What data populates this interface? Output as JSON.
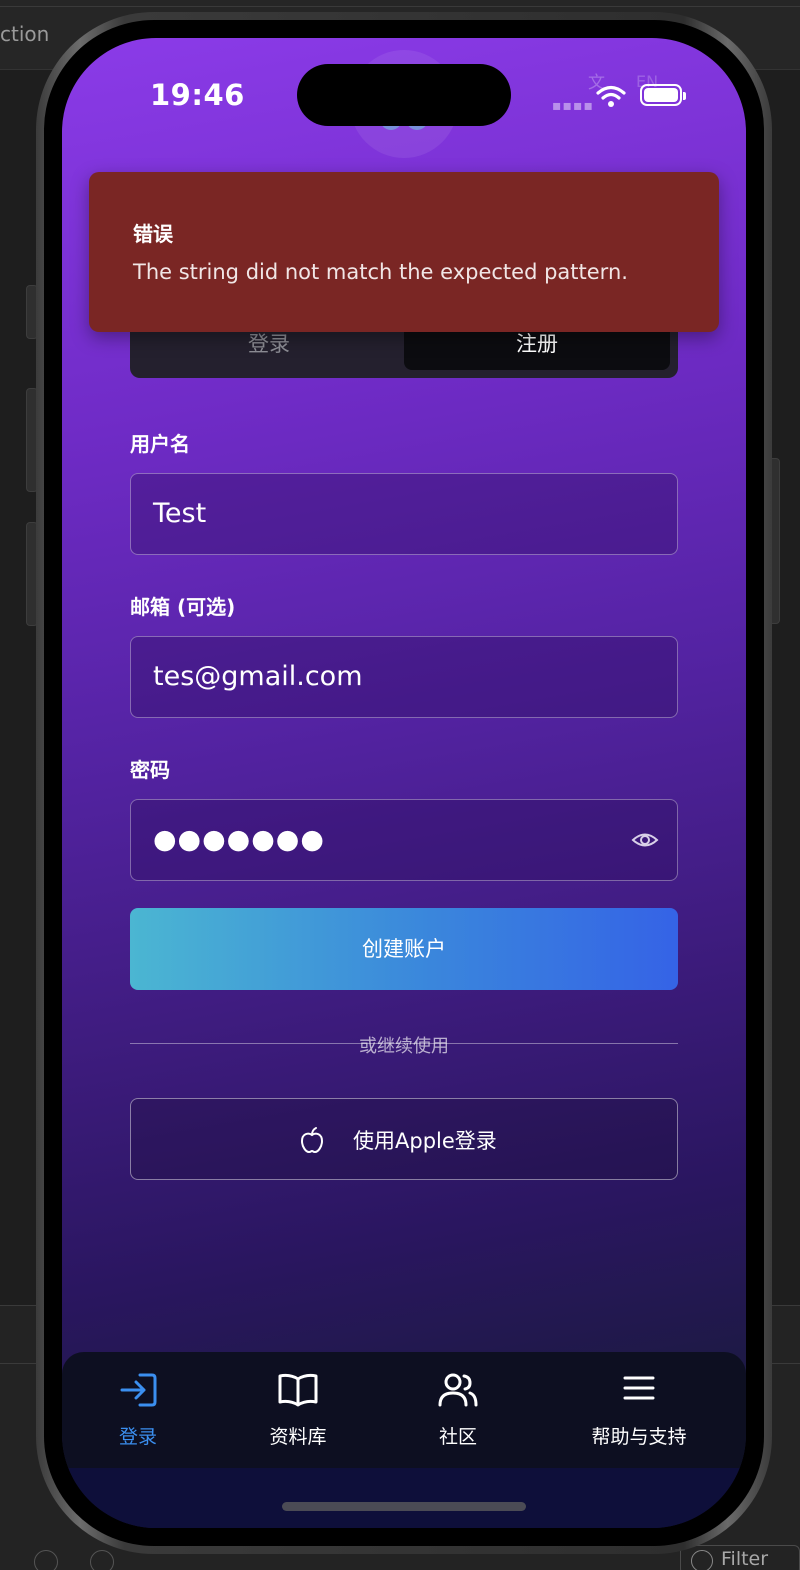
{
  "ide": {
    "partial_title": "ction",
    "filter_label": "Filter"
  },
  "status_bar": {
    "time": "19:46",
    "ghost_glyph_1": "文",
    "ghost_glyph_2": "EN"
  },
  "toast": {
    "title": "错误",
    "message": "The string did not match the expected pattern."
  },
  "segmented": {
    "login_label": "登录",
    "register_label": "注册",
    "selected": "注册"
  },
  "form": {
    "username": {
      "label": "用户名",
      "value": "Test"
    },
    "email": {
      "label": "邮箱 (可选)",
      "value": "tes@gmail.com"
    },
    "password": {
      "label": "密码",
      "masked_value": "●●●●●●●"
    },
    "create_button": "创建账户",
    "divider_text": "或继续使用",
    "apple_button": "使用Apple登录"
  },
  "tabbar": {
    "tabs": [
      {
        "label": "登录",
        "icon": "login-arrow-icon",
        "active": true
      },
      {
        "label": "资料库",
        "icon": "book-icon",
        "active": false
      },
      {
        "label": "社区",
        "icon": "users-icon",
        "active": false
      },
      {
        "label": "帮助与支持",
        "icon": "menu-icon",
        "active": false
      }
    ]
  },
  "colors": {
    "toast_bg": "#7a2624",
    "accent_blue": "#3b8ff0",
    "gradient_top": "#8b3be8",
    "button_gradient_start": "#4bb6d2",
    "button_gradient_end": "#3563e6"
  }
}
